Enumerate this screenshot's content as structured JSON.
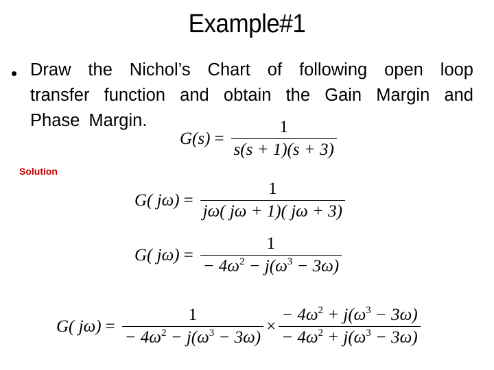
{
  "slide": {
    "title": "Example#1",
    "bullet_char": "•",
    "paragraph_lines": [
      "Draw the Nichol’s Chart of following open loop",
      "transfer function and obtain the Gain Margin and",
      "Phase Margin."
    ],
    "solution_label": "Solution"
  },
  "equations": {
    "eq1": {
      "lhs": "G(s)",
      "eq": "=",
      "num": "1",
      "den": "s(s + 1)(s + 3)"
    },
    "eq2": {
      "lhs": "G( jω)",
      "eq": "=",
      "num": "1",
      "den": "jω( jω + 1)( jω + 3)"
    },
    "eq3": {
      "lhs": "G( jω)",
      "eq": "=",
      "num": "1",
      "den_a": "− 4ω",
      "den_a_sup": "2",
      "den_b": " − j(ω",
      "den_b_sup": "3",
      "den_c": " − 3ω)"
    },
    "eq4": {
      "lhs": "G( jω)",
      "eq": "=",
      "f1_num": "1",
      "f1_den_a": "− 4ω",
      "f1_den_a_sup": "2",
      "f1_den_b": " − j(ω",
      "f1_den_b_sup": "3",
      "f1_den_c": " − 3ω)",
      "times": "×",
      "f2_num_a": "− 4ω",
      "f2_num_a_sup": "2",
      "f2_num_b": " + j(ω",
      "f2_num_b_sup": "3",
      "f2_num_c": " − 3ω)",
      "f2_den_a": "− 4ω",
      "f2_den_a_sup": "2",
      "f2_den_b": " + j(ω",
      "f2_den_b_sup": "3",
      "f2_den_c": " − 3ω)"
    }
  }
}
